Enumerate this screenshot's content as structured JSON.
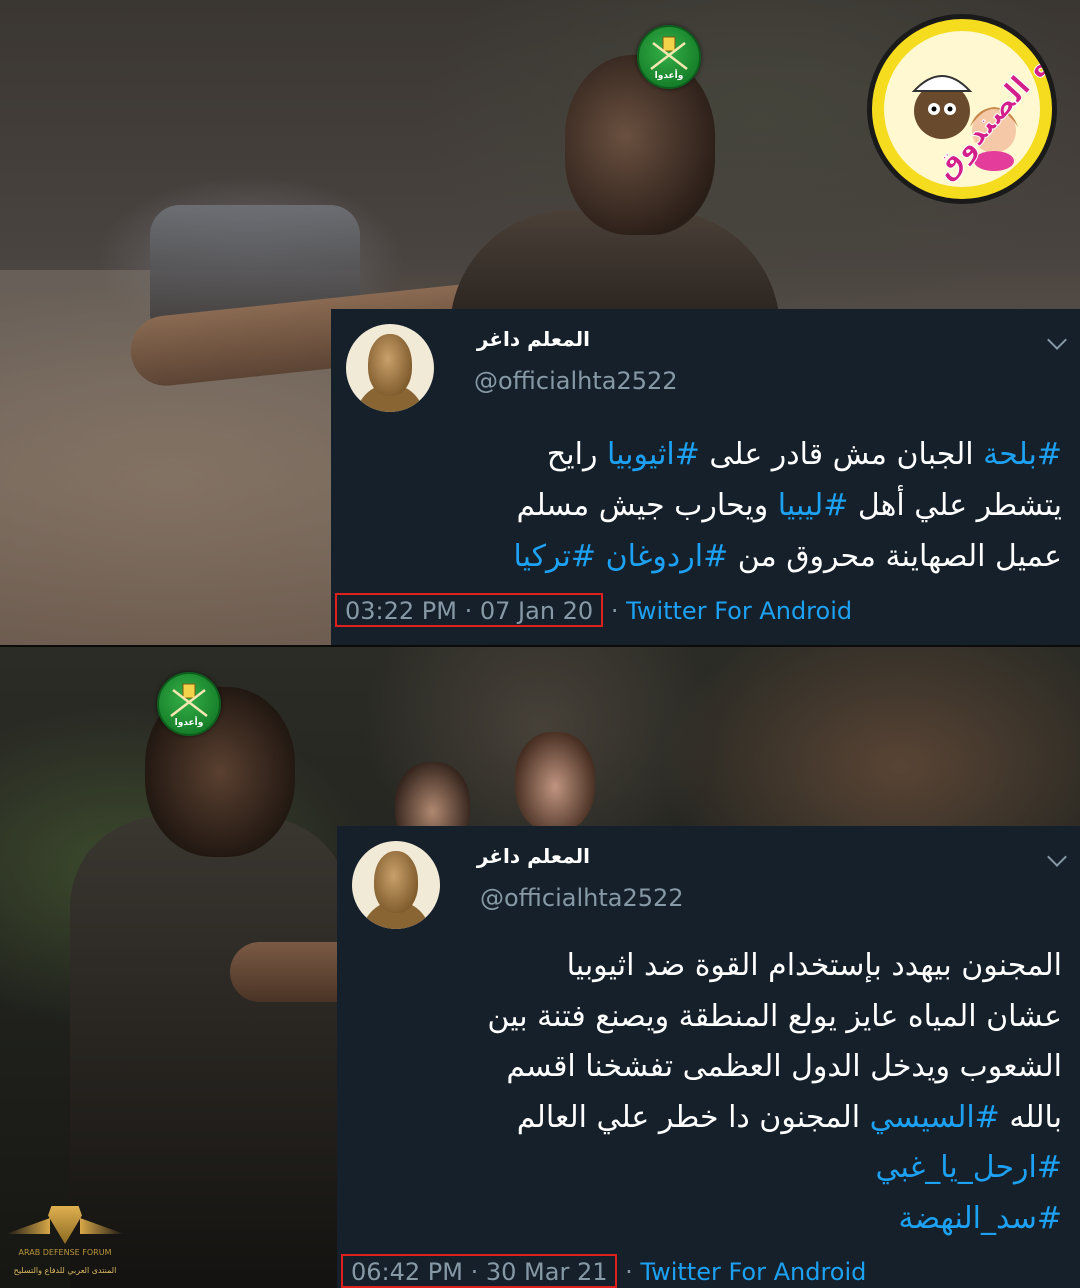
{
  "logo": {
    "text": "بره الصندوق"
  },
  "emblem": {
    "text": "وأعدوا"
  },
  "tweets": [
    {
      "name": "المعلم داغر",
      "handle": "@officialhta2522",
      "lines": [
        [
          {
            "t": "#بلحة",
            "tag": true
          },
          {
            "t": " الجبان مش قادر على ",
            "tag": false
          },
          {
            "t": "#اثيوبيا",
            "tag": true
          },
          {
            "t": " رايح",
            "tag": false
          }
        ],
        [
          {
            "t": "يتشطر علي أهل ",
            "tag": false
          },
          {
            "t": "#ليبيا",
            "tag": true
          },
          {
            "t": " ويحارب جيش مسلم",
            "tag": false
          }
        ],
        [
          {
            "t": "عميل الصهاينة محروق من ",
            "tag": false
          },
          {
            "t": "#اردوغان",
            "tag": true
          },
          {
            "t": " ",
            "tag": false
          },
          {
            "t": "#تركيا",
            "tag": true
          }
        ]
      ],
      "time": "03:22 PM · 07 Jan 20",
      "source": "Twitter For Android"
    },
    {
      "name": "المعلم داغر",
      "handle": "@officialhta2522",
      "lines": [
        [
          {
            "t": "المجنون بيهدد بإستخدام القوة ضد اثيوبيا",
            "tag": false
          }
        ],
        [
          {
            "t": "عشان المياه عايز يولع المنطقة ويصنع فتنة بين",
            "tag": false
          }
        ],
        [
          {
            "t": "الشعوب ويدخل الدول العظمى تفشخنا اقسم",
            "tag": false
          }
        ],
        [
          {
            "t": "بالله ",
            "tag": false
          },
          {
            "t": "#السيسي",
            "tag": true
          },
          {
            "t": " المجنون دا خطر علي العالم",
            "tag": false
          }
        ],
        [
          {
            "t": "#ارحل_يا_غبي",
            "tag": true
          }
        ],
        [
          {
            "t": "#سد_النهضة",
            "tag": true
          }
        ]
      ],
      "time": "06:42 PM · 30 Mar 21",
      "source": "Twitter For Android"
    }
  ],
  "watermark": {
    "en": "ARAB DEFENSE FORUM",
    "ar": "المنتدى العربي للدفاع والتسليح"
  }
}
